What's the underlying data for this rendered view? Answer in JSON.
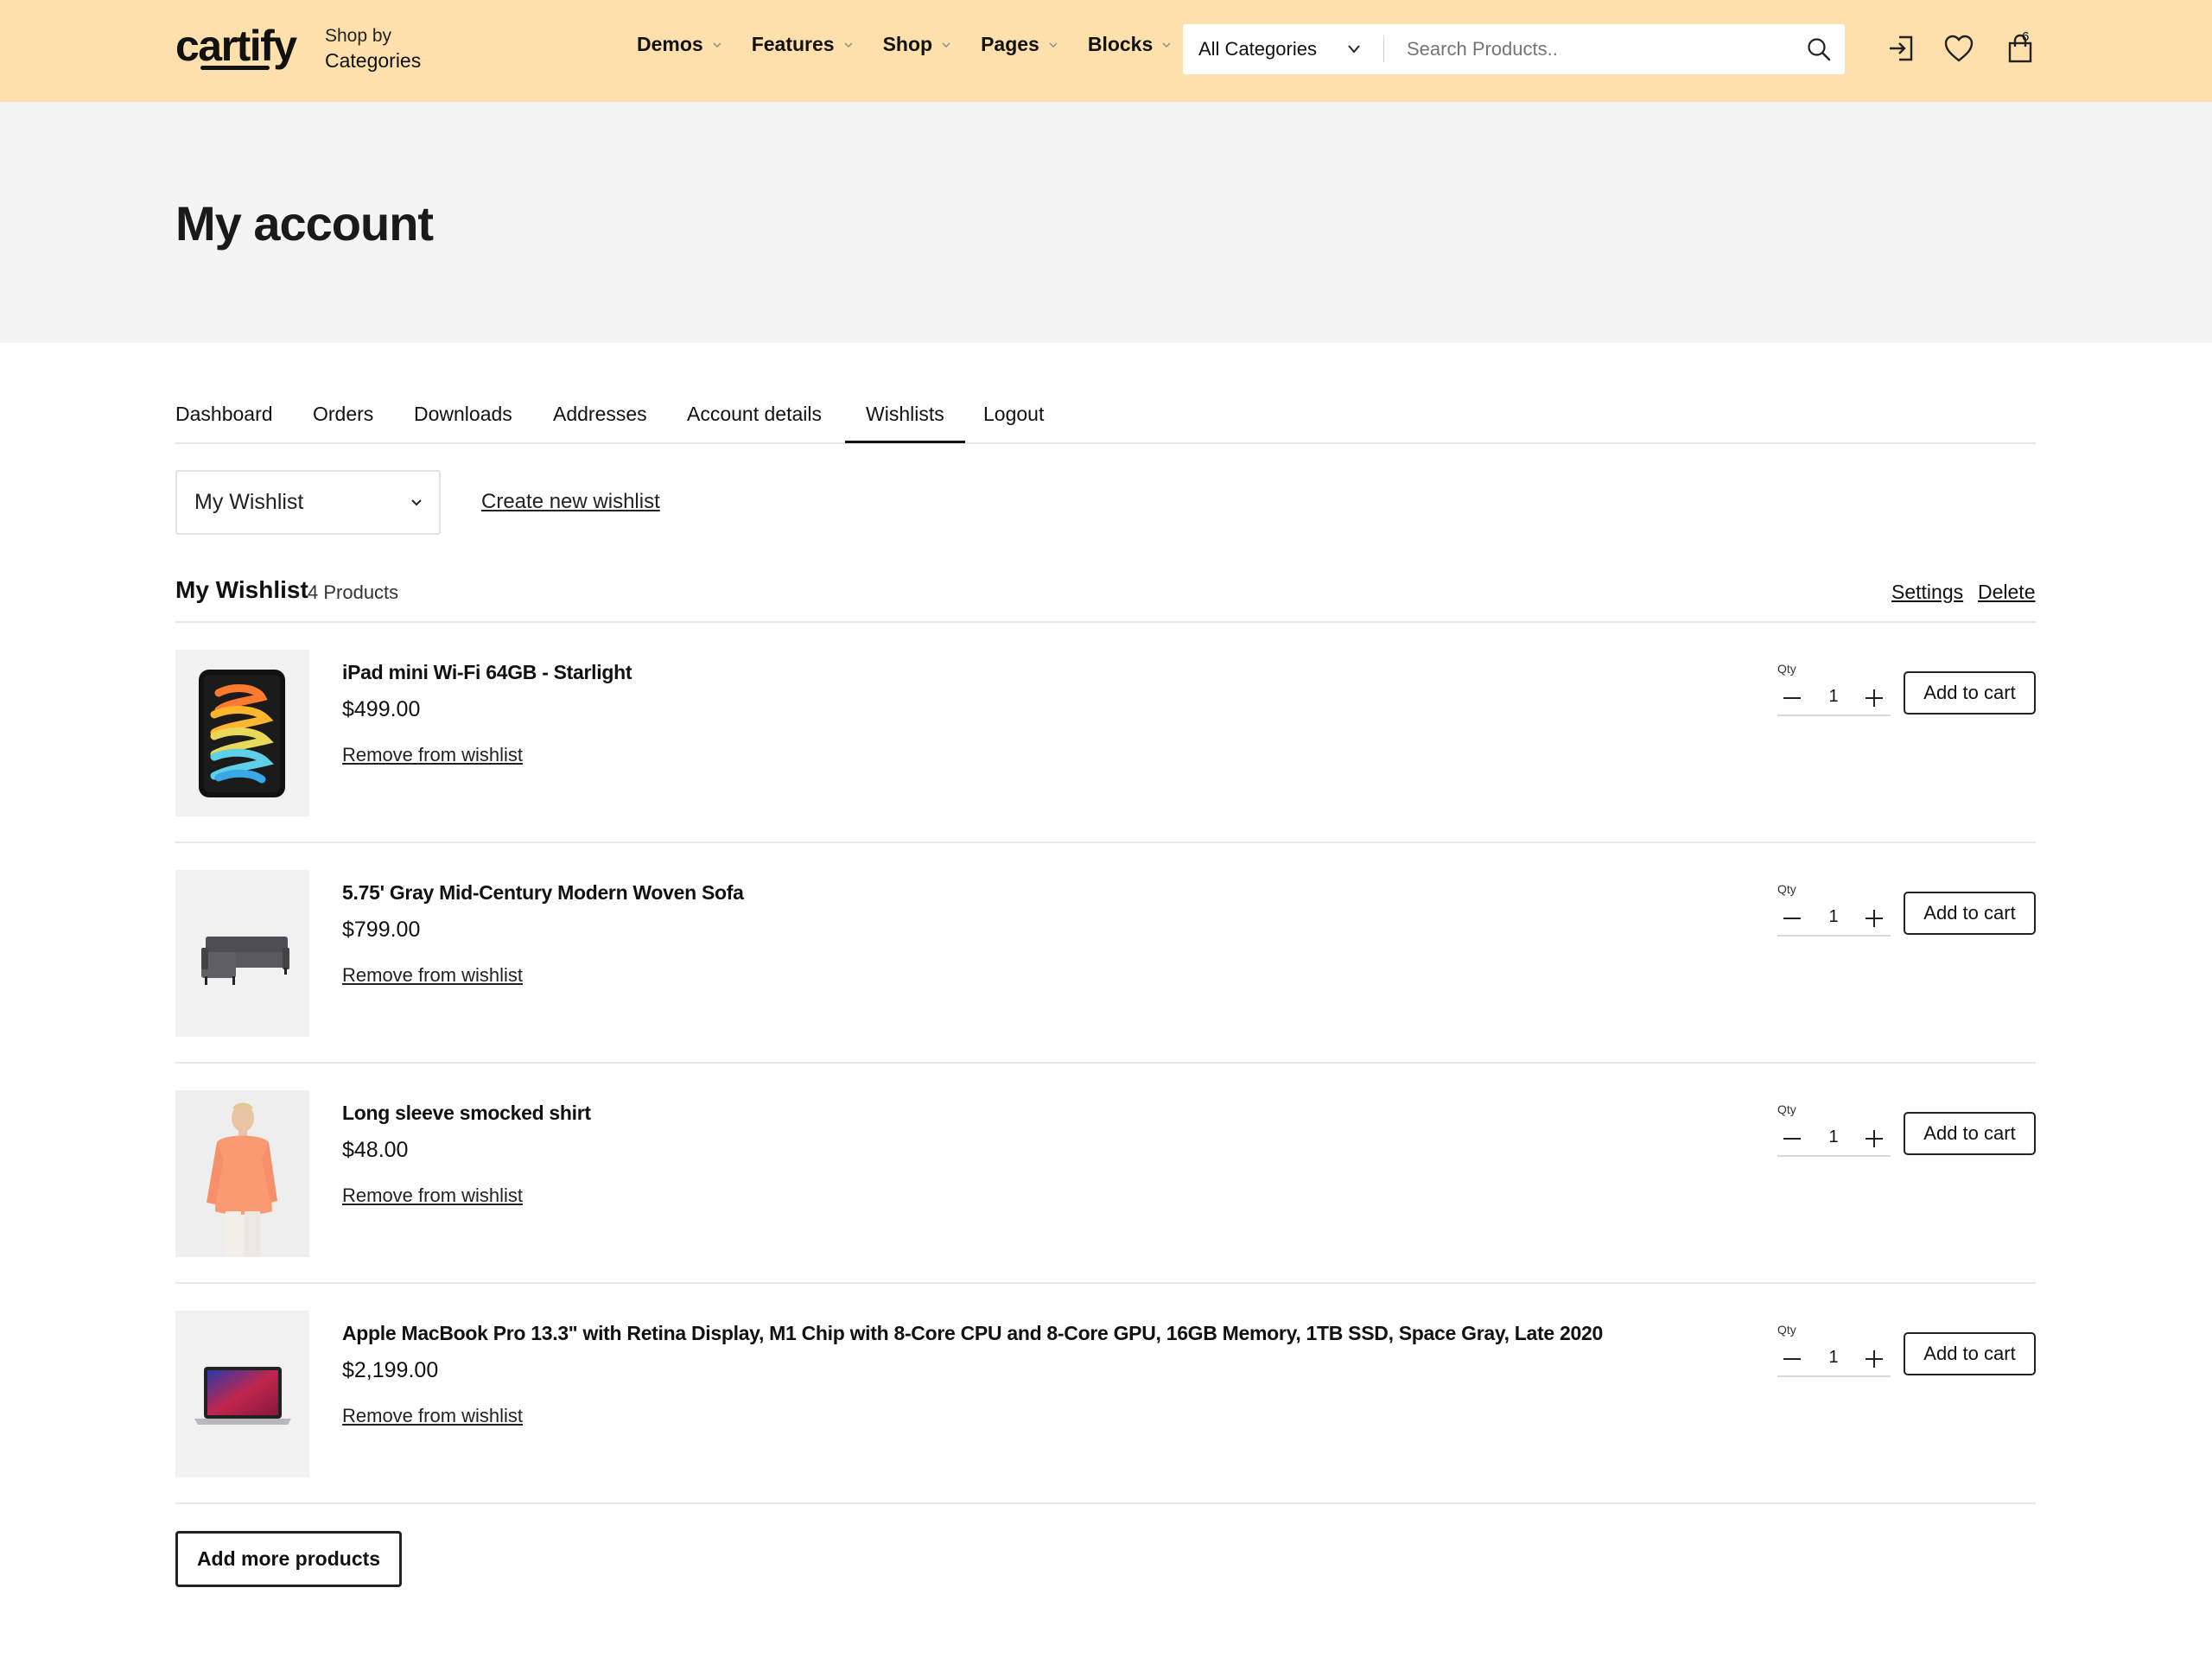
{
  "brand": {
    "logo": "cartify",
    "shop_by_small": "Shop by",
    "shop_by_big": "Categories",
    "header_bg": "#fde0ab"
  },
  "nav": [
    "Demos",
    "Features",
    "Shop",
    "Pages",
    "Blocks"
  ],
  "search": {
    "category": "All Categories",
    "placeholder": "Search Products.."
  },
  "header_icons": {
    "login": "login-icon",
    "wishlist": "heart-icon",
    "cart": "cart-icon",
    "cart_count": "6"
  },
  "page_title": "My account",
  "tabs": [
    "Dashboard",
    "Orders",
    "Downloads",
    "Addresses",
    "Account details",
    "Wishlists",
    "Logout"
  ],
  "active_tab": "Wishlists",
  "wishlist": {
    "selected": "My Wishlist",
    "create_link": "Create new wishlist",
    "heading": "My Wishlist",
    "count": "4 Products",
    "settings": "Settings",
    "delete": "Delete"
  },
  "labels": {
    "qty": "Qty",
    "remove": "Remove from wishlist",
    "add_to_cart": "Add to cart",
    "add_more": "Add more products"
  },
  "products": [
    {
      "name": "iPad mini Wi-Fi 64GB - Starlight",
      "price": "$499.00",
      "qty": "1",
      "image": "ipad-image"
    },
    {
      "name": "5.75' Gray Mid-Century Modern Woven Sofa",
      "price": "$799.00",
      "qty": "1",
      "image": "sofa-image"
    },
    {
      "name": "Long sleeve smocked shirt",
      "price": "$48.00",
      "qty": "1",
      "image": "shirt-model-image"
    },
    {
      "name": "Apple MacBook Pro 13.3\" with Retina Display, M1 Chip with 8-Core CPU and 8-Core GPU, 16GB Memory, 1TB SSD, Space Gray, Late 2020",
      "price": "$2,199.00",
      "qty": "1",
      "image": "macbook-image"
    }
  ]
}
